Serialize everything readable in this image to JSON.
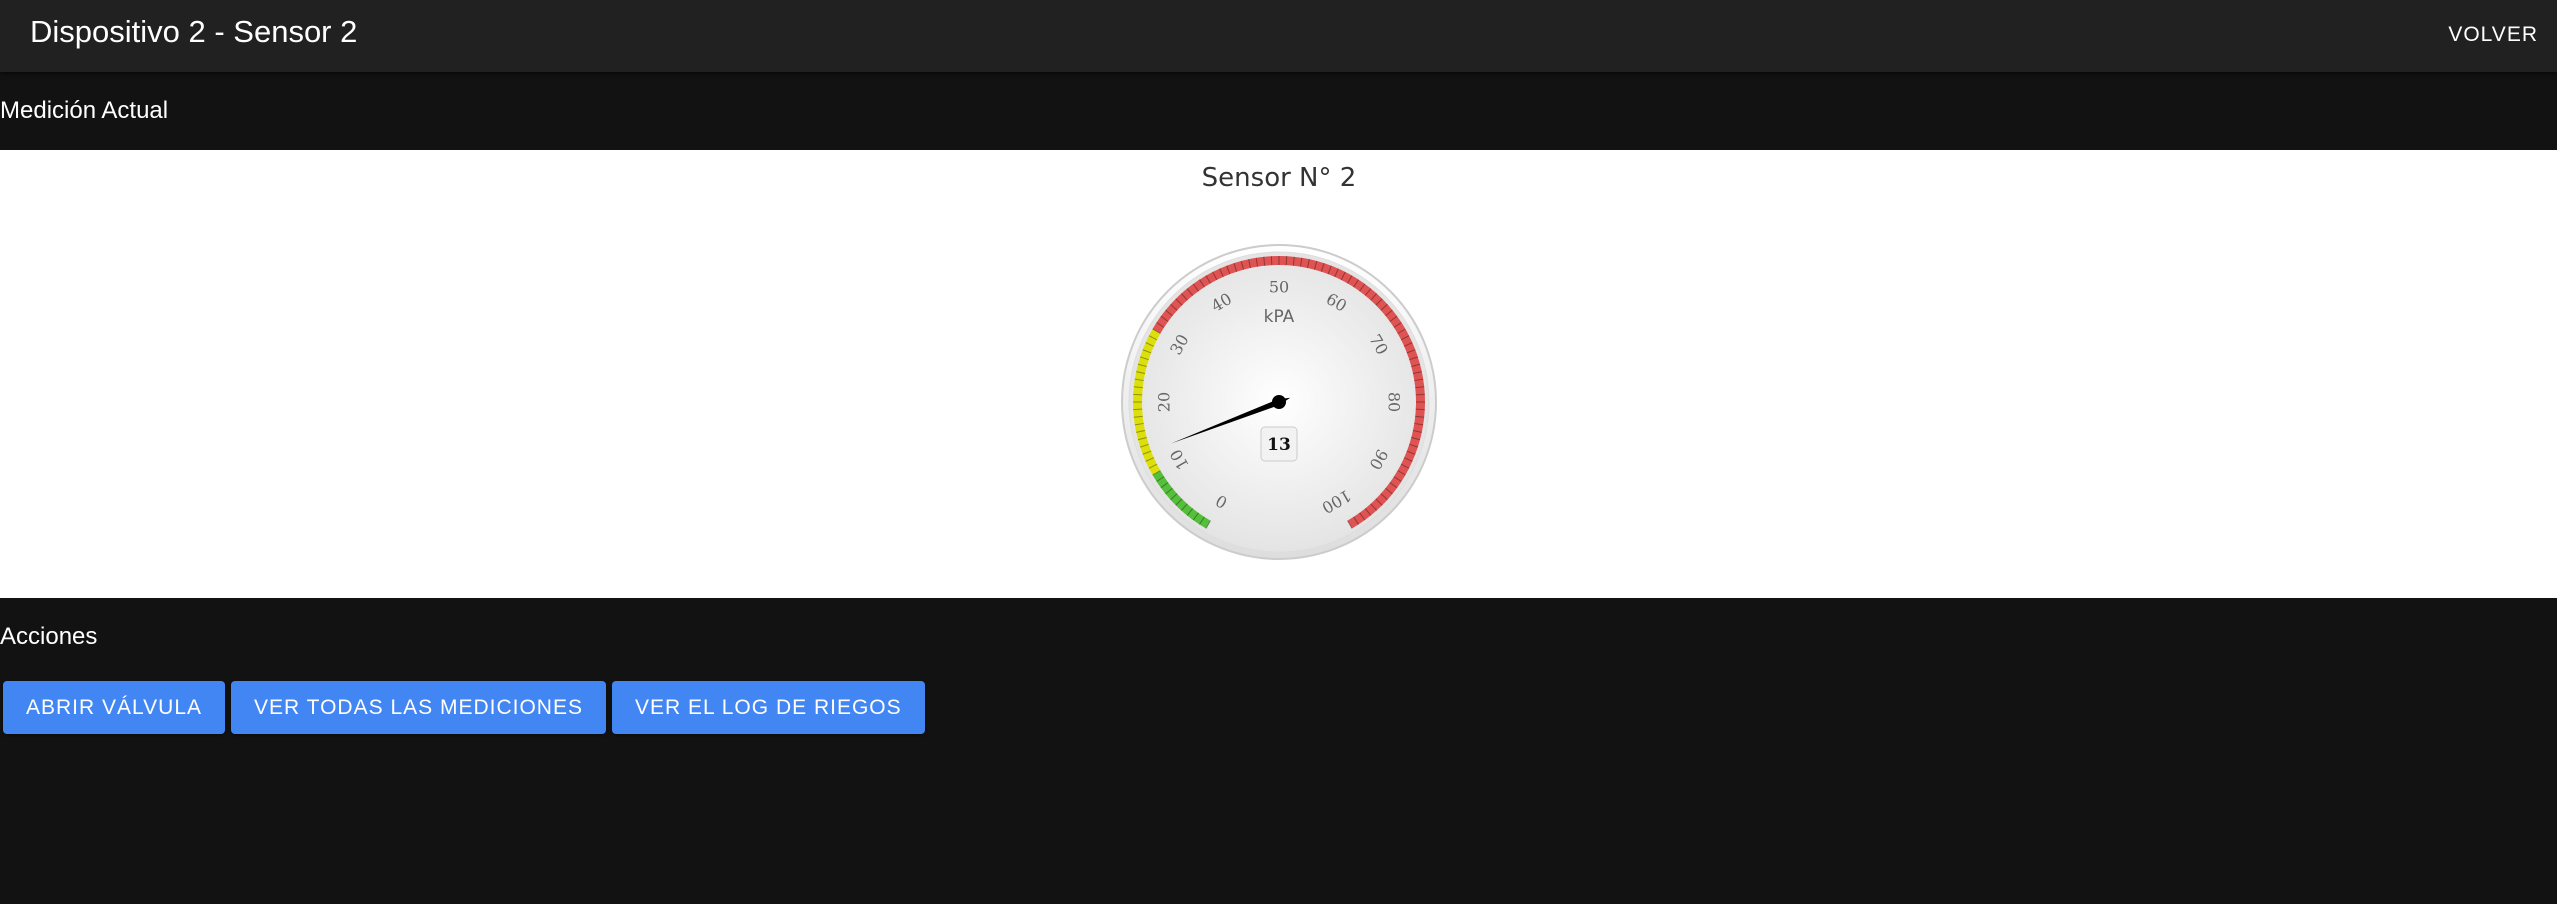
{
  "header": {
    "title": "Dispositivo 2 - Sensor 2",
    "back_label": "VOLVER"
  },
  "current_measurement": {
    "heading": "Medición Actual",
    "gauge": {
      "title": "Sensor N° 2",
      "unit": "kPA",
      "value": 13,
      "min": 0,
      "max": 100,
      "ticks": [
        "0",
        "10",
        "20",
        "30",
        "40",
        "50",
        "60",
        "70",
        "80",
        "90",
        "100"
      ],
      "bands": [
        {
          "from": 0,
          "to": 10,
          "color": "#55bf3b"
        },
        {
          "from": 10,
          "to": 30,
          "color": "#dddf0d"
        },
        {
          "from": 30,
          "to": 100,
          "color": "#df5353"
        }
      ]
    }
  },
  "actions": {
    "heading": "Acciones",
    "buttons": [
      {
        "label": "ABRIR VÁLVULA"
      },
      {
        "label": "VER TODAS LAS MEDICIONES"
      },
      {
        "label": "VER EL LOG DE RIEGOS"
      }
    ],
    "button_color": "#4286f4"
  },
  "colors": {
    "background": "#121212",
    "appbar": "#212121",
    "panel": "#ffffff"
  }
}
